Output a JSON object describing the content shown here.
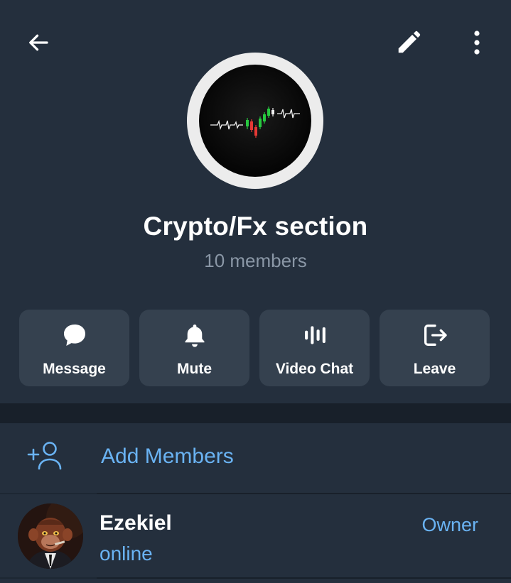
{
  "group": {
    "title": "Crypto/Fx section",
    "subtitle": "10 members"
  },
  "toolbar": {
    "back_icon": "arrow-left-icon",
    "edit_icon": "pencil-icon",
    "more_icon": "more-vertical-icon"
  },
  "actions": [
    {
      "label": "Message",
      "icon": "chat-bubble-icon"
    },
    {
      "label": "Mute",
      "icon": "bell-icon"
    },
    {
      "label": "Video Chat",
      "icon": "voice-wave-icon"
    },
    {
      "label": "Leave",
      "icon": "logout-icon"
    }
  ],
  "add_members": {
    "label": "Add Members",
    "icon": "add-person-icon"
  },
  "members": [
    {
      "name": "Ezekiel",
      "status": "online",
      "role": "Owner"
    }
  ],
  "colors": {
    "header_bg": "#242f3d",
    "list_bg": "#242f3d",
    "separator": "#18202a",
    "button_bg": "#35414f",
    "accent": "#6ab3f3",
    "muted_text": "#8a97a6"
  }
}
